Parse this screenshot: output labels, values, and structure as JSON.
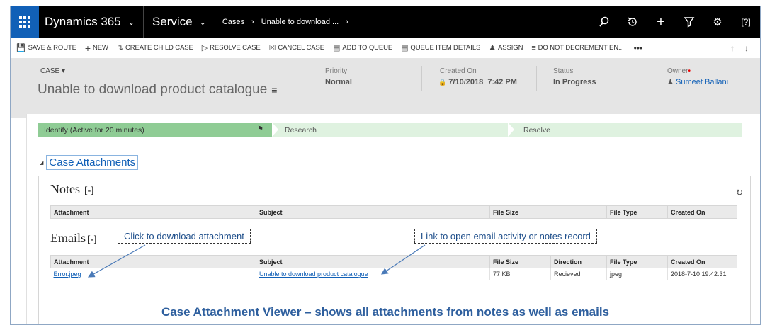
{
  "nav": {
    "app": "Dynamics 365",
    "module": "Service",
    "breadcrumb": [
      "Cases",
      "Unable to download ..."
    ],
    "icons": [
      "search-icon",
      "history-icon",
      "plus-icon",
      "filter-icon",
      "gear-icon",
      "help-icon"
    ]
  },
  "commands": [
    {
      "icon": "save-route-icon",
      "label": "SAVE & ROUTE"
    },
    {
      "icon": "plus-icon",
      "label": "NEW"
    },
    {
      "icon": "child-case-icon",
      "label": "CREATE CHILD CASE"
    },
    {
      "icon": "resolve-icon",
      "label": "RESOLVE CASE"
    },
    {
      "icon": "cancel-icon",
      "label": "CANCEL CASE"
    },
    {
      "icon": "queue-add-icon",
      "label": "ADD TO QUEUE"
    },
    {
      "icon": "queue-details-icon",
      "label": "QUEUE ITEM DETAILS"
    },
    {
      "icon": "assign-icon",
      "label": "ASSIGN"
    },
    {
      "icon": "decrement-icon",
      "label": "DO NOT DECREMENT EN..."
    }
  ],
  "header": {
    "entity": "CASE",
    "title": "Unable to download product catalogue",
    "priority_label": "Priority",
    "priority": "Normal",
    "created_label": "Created On",
    "created": "7/10/2018  7:42 PM",
    "status_label": "Status",
    "status": "In Progress",
    "owner_label": "Owner",
    "owner": "Sumeet Ballani"
  },
  "process": {
    "active": "Identify (Active for 20 minutes)",
    "stages": [
      "Research",
      "Resolve"
    ]
  },
  "section_title": "Case Attachments",
  "notes": {
    "title": "Notes",
    "toggle": "[-]",
    "columns": [
      "Attachment",
      "Subject",
      "File Size",
      "File Type",
      "Created On"
    ]
  },
  "emails": {
    "title": "Emails",
    "toggle": "[-]",
    "columns": [
      "Attachment",
      "Subject",
      "File Size",
      "Direction",
      "File Type",
      "Created On"
    ],
    "rows": [
      [
        "Error.jpeg",
        "Unable to download product catalogue",
        "77 KB",
        "Recieved",
        "jpeg",
        "2018-7-10 19:42:31"
      ]
    ]
  },
  "callouts": {
    "download": "Click to download attachment",
    "open": "Link to open email activity or notes record"
  },
  "caption": "Case Attachment Viewer – shows all attachments from notes as well as emails"
}
